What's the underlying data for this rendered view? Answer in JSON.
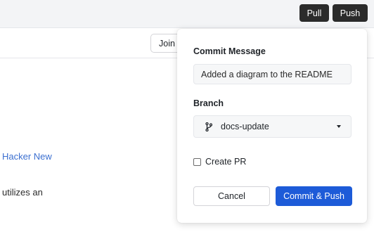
{
  "toolbar": {
    "pull_label": "Pull",
    "push_label": "Push"
  },
  "subbar": {
    "join_label": "Join"
  },
  "background": {
    "link_text": "Hacker New",
    "body_text": "utilizes an"
  },
  "commit_panel": {
    "message_label": "Commit Message",
    "message_value": "Added a diagram to the README",
    "branch_label": "Branch",
    "branch_value": "docs-update",
    "branch_icon": "git-branch-icon",
    "create_pr_label": "Create PR",
    "create_pr_checked": false,
    "cancel_label": "Cancel",
    "commit_label": "Commit & Push"
  },
  "colors": {
    "primary": "#1d5bd8",
    "toolbar_button": "#2b2b2b",
    "link": "#3b6fd0"
  }
}
